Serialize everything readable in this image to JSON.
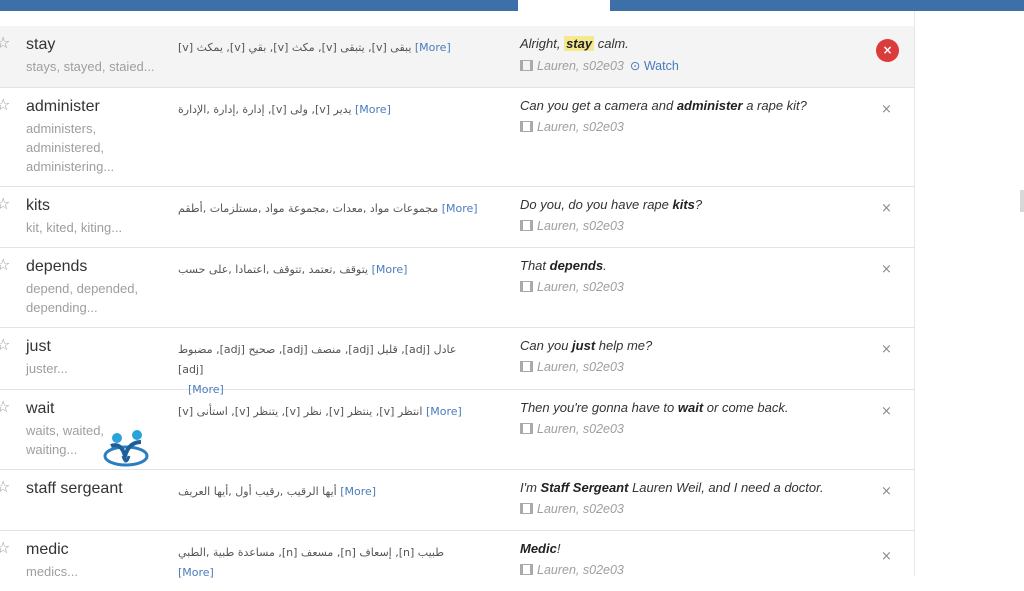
{
  "more_label": "[More]",
  "watch_label": "Watch",
  "delete_glyph": "×",
  "rows": [
    {
      "word": "stay",
      "forms": "stays, stayed, staied...",
      "translation": "يبقى [v], يتبقى [v], مكث [v], بقي [v], يمكث [v]",
      "example_pre": "Alright, ",
      "example_word": "stay",
      "example_post": " calm.",
      "source": "Lauren, s02e03"
    },
    {
      "word": "administer",
      "forms": "administers, administered, administering...",
      "translation": "يدير [v], ولى [v], إدارة ,إدارة ,الإدارة",
      "example_pre": "Can you get a camera and ",
      "example_word": "administer",
      "example_post": " a rape kit?",
      "source": "Lauren, s02e03"
    },
    {
      "word": "kits",
      "forms": "kit, kited, kiting...",
      "translation": "مجموعات مواد ,معدات ,مجموعة مواد ,مستلزمات ,أطقم",
      "example_pre": "Do you, do you have rape ",
      "example_word": "kits",
      "example_post": "?",
      "source": "Lauren, s02e03"
    },
    {
      "word": "depends",
      "forms": "depend, depended, depending...",
      "translation": "يتوقف ,تعتمد ,تتوقف ,اعتمادا ,على حسب",
      "example_pre": "That ",
      "example_word": "depends",
      "example_post": ".",
      "source": "Lauren, s02e03"
    },
    {
      "word": "just",
      "forms": "juster...",
      "translation": "عادل [adj], قليل [adj], منصف [adj], صحيح [adj], مضبوط [adj]",
      "example_pre": "Can you ",
      "example_word": "just",
      "example_post": " help me?",
      "source": "Lauren, s02e03"
    },
    {
      "word": "wait",
      "forms": "waits, waited, waiting...",
      "translation": "انتظر [v], ينتظر [v], نظر [v], يتنظر [v], استأنى [v]",
      "example_pre": "Then you're gonna have to ",
      "example_word": "wait",
      "example_post": " or come back.",
      "source": "Lauren, s02e03"
    },
    {
      "word": "staff sergeant",
      "forms": "",
      "translation": "أيها الرقيب ,رقيب أول ,أيها العريف",
      "example_pre": "I'm ",
      "example_word": "Staff Sergeant",
      "example_post": " Lauren Weil, and I need a doctor.",
      "source": "Lauren, s02e03"
    },
    {
      "word": "medic",
      "forms": "medics...",
      "translation": "طبيب [n], إسعاف [n], مسعف [n], مساعدة طبية ,الطبي",
      "example_pre": "",
      "example_word": "Medic",
      "example_post": "!",
      "source": "Lauren, s02e03"
    }
  ]
}
